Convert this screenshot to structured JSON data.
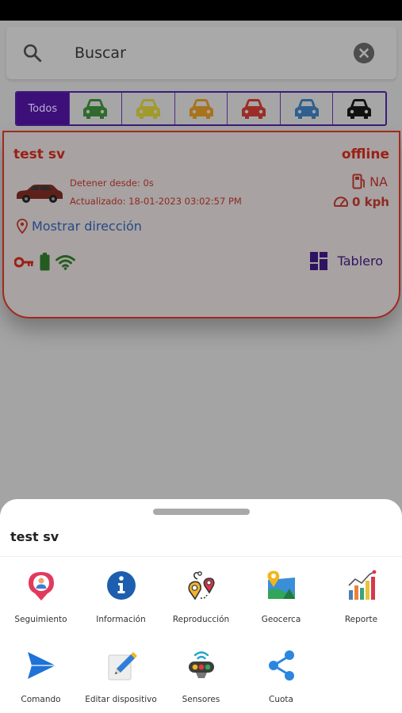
{
  "search": {
    "placeholder": "Buscar",
    "value": ""
  },
  "filters": {
    "all_label": "Todos",
    "cars": [
      {
        "name": "car-green-icon",
        "color": "#2f6b2c"
      },
      {
        "name": "car-yellow-icon",
        "color": "#a29a2a"
      },
      {
        "name": "car-orange-icon",
        "color": "#a8731c"
      },
      {
        "name": "car-red-icon",
        "color": "#9b2d26"
      },
      {
        "name": "car-blue-icon",
        "color": "#2f5f8f"
      },
      {
        "name": "car-black-icon",
        "color": "#111111"
      }
    ]
  },
  "device": {
    "name": "test sv",
    "status": "offline",
    "stopped_since": "Detener desde: 0s",
    "updated": "Actualizado: 18-01-2023 03:02:57 PM",
    "fuel": "NA",
    "speed": "0 kph",
    "address_link": "Mostrar dirección",
    "dashboard_label": "Tablero",
    "status_color": "#9b2015"
  },
  "sheet": {
    "title": "test sv",
    "actions": [
      {
        "label": "Seguimiento",
        "icon": "tracking-icon"
      },
      {
        "label": "Información",
        "icon": "info-icon"
      },
      {
        "label": "Reproducción",
        "icon": "playback-icon"
      },
      {
        "label": "Geocerca",
        "icon": "geofence-icon"
      },
      {
        "label": "Reporte",
        "icon": "report-icon"
      },
      {
        "label": "Comando",
        "icon": "command-icon"
      },
      {
        "label": "Editar dispositivo",
        "icon": "edit-device-icon"
      },
      {
        "label": "Sensores",
        "icon": "sensors-icon"
      },
      {
        "label": "Cuota",
        "icon": "share-icon"
      }
    ]
  }
}
